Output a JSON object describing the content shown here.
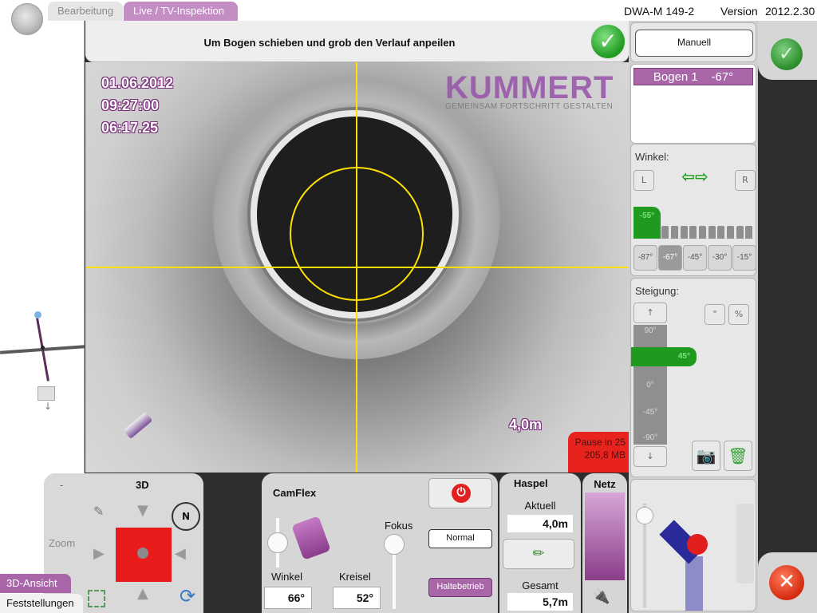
{
  "top_bar": {
    "tabs": [
      {
        "label": "Bearbeitung",
        "active": false
      },
      {
        "label": "Live / TV-Inspektion",
        "active": true
      }
    ],
    "standard": "DWA-M 149-2",
    "version_label": "Version",
    "version_value": "2012.2.30"
  },
  "instruction": {
    "text": "Um Bogen schieben und grob den Verlauf anpeilen",
    "confirm_icon": "check-icon"
  },
  "video": {
    "date": "01.06.2012",
    "time": "09:27:00",
    "counter": "06:17.25",
    "brand": "KUMMERT",
    "brand_tagline": "GEMEINSAM FORTSCHRITT GESTALTEN",
    "distance": "4,0m",
    "pause_text": "Pause in 25",
    "pause_size": "205,8 MB",
    "crosshair_color": "#ffe100"
  },
  "right_panel": {
    "mode_button": "Manuell",
    "bends": [
      {
        "label": "Bogen 1",
        "angle": "-67°"
      }
    ],
    "winkel": {
      "title": "Winkel:",
      "left_label": "L",
      "right_label": "R",
      "marker_value": "-55°",
      "presets": [
        {
          "label": "-87°",
          "selected": false
        },
        {
          "label": "-67°",
          "selected": true
        },
        {
          "label": "-45°",
          "selected": false
        },
        {
          "label": "-30°",
          "selected": false
        },
        {
          "label": "-15°",
          "selected": false
        }
      ]
    },
    "steigung": {
      "title": "Steigung:",
      "up_icon": "↑",
      "down_icon": "↓",
      "degree_label": "°",
      "percent_label": "%",
      "scale_labels": [
        "90°",
        "0°",
        "-45°",
        "-90°"
      ],
      "marker_value": "45°"
    }
  },
  "control_3d": {
    "minus": "-",
    "title": "3D",
    "zoom_label": "Zoom",
    "compass": "N"
  },
  "bottom_tabs": {
    "view_3d": "3D-Ansicht",
    "findings": "Feststellungen"
  },
  "camflex": {
    "title": "CamFlex",
    "fokus_label": "Fokus",
    "normal_button": "Normal",
    "halt_button": "Haltebetrieb",
    "winkel_label": "Winkel",
    "winkel_value": "66°",
    "kreisel_label": "Kreisel",
    "kreisel_value": "52°",
    "tilt_level_fraction": 0.55,
    "focus_level_fraction": 0.9
  },
  "haspel": {
    "title": "Haspel",
    "current_label": "Aktuell",
    "current_value": "4,0m",
    "total_label": "Gesamt",
    "total_value": "5,7m"
  },
  "netz": {
    "title": "Netz",
    "level_fraction": 1.0,
    "bar_color": "#a865a8"
  },
  "colors": {
    "accent_purple": "#a865a8",
    "confirm_green": "#1f9a1f",
    "cancel_red": "#d42a10",
    "pause_red": "#e8231e"
  }
}
